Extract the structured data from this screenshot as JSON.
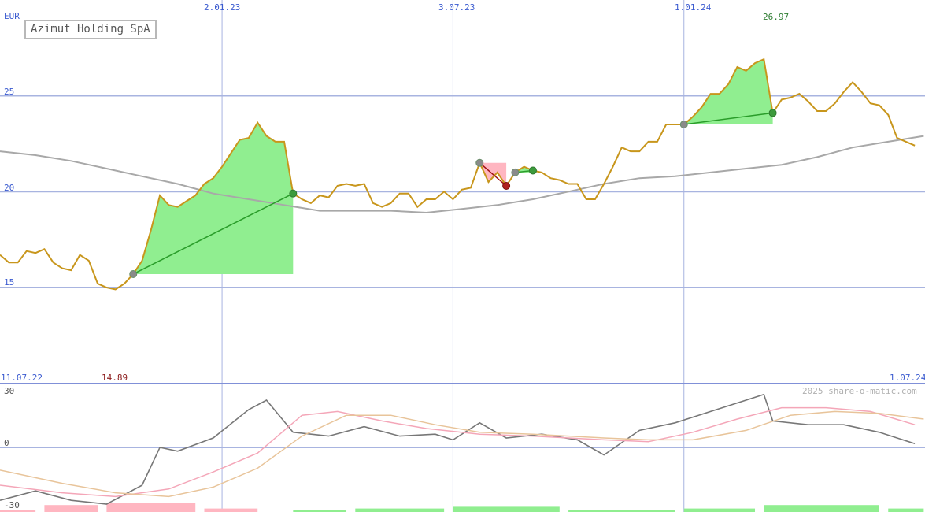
{
  "chart_data": [
    {
      "type": "line",
      "title": "Azimut Holding SpA",
      "currency_label": "EUR",
      "x_range": [
        "2022-07-11",
        "2024-07-09"
      ],
      "x_labels": [
        "2.01.23",
        "3.07.23",
        "1.01.24"
      ],
      "range_start_label": "11.07.22",
      "range_end_label": "1.07.24",
      "y_ticks": [
        "25",
        "20",
        "15"
      ],
      "ylim": [
        13.4,
        29.8
      ],
      "low_label": "14.89",
      "high_label": "26.97",
      "series": [
        {
          "color": "#c8961c",
          "points": [
            [
              "2022-07-11",
              16.7
            ],
            [
              "2022-07-18",
              16.3
            ],
            [
              "2022-07-25",
              16.3
            ],
            [
              "2022-08-01",
              16.9
            ],
            [
              "2022-08-08",
              16.8
            ],
            [
              "2022-08-15",
              17.0
            ],
            [
              "2022-08-22",
              16.3
            ],
            [
              "2022-08-29",
              16.0
            ],
            [
              "2022-09-05",
              15.9
            ],
            [
              "2022-09-12",
              16.7
            ],
            [
              "2022-09-19",
              16.4
            ],
            [
              "2022-09-26",
              15.2
            ],
            [
              "2022-10-03",
              15.0
            ],
            [
              "2022-10-10",
              14.9
            ],
            [
              "2022-10-17",
              15.2
            ],
            [
              "2022-10-24",
              15.7
            ],
            [
              "2022-10-31",
              16.4
            ],
            [
              "2022-11-07",
              18.0
            ],
            [
              "2022-11-14",
              19.8
            ],
            [
              "2022-11-21",
              19.3
            ],
            [
              "2022-11-28",
              19.2
            ],
            [
              "2022-12-05",
              19.5
            ],
            [
              "2022-12-12",
              19.8
            ],
            [
              "2022-12-19",
              20.4
            ],
            [
              "2022-12-26",
              20.7
            ],
            [
              "2023-01-02",
              21.3
            ],
            [
              "2023-01-09",
              22.0
            ],
            [
              "2023-01-16",
              22.7
            ],
            [
              "2023-01-23",
              22.8
            ],
            [
              "2023-01-30",
              23.6
            ],
            [
              "2023-02-06",
              22.9
            ],
            [
              "2023-02-13",
              22.6
            ],
            [
              "2023-02-20",
              22.6
            ],
            [
              "2023-02-27",
              19.9
            ],
            [
              "2023-03-06",
              19.6
            ],
            [
              "2023-03-13",
              19.4
            ],
            [
              "2023-03-20",
              19.8
            ],
            [
              "2023-03-27",
              19.7
            ],
            [
              "2023-04-03",
              20.3
            ],
            [
              "2023-04-10",
              20.4
            ],
            [
              "2023-04-17",
              20.3
            ],
            [
              "2023-04-24",
              20.4
            ],
            [
              "2023-05-01",
              19.4
            ],
            [
              "2023-05-08",
              19.2
            ],
            [
              "2023-05-15",
              19.4
            ],
            [
              "2023-05-22",
              19.9
            ],
            [
              "2023-05-29",
              19.9
            ],
            [
              "2023-06-05",
              19.2
            ],
            [
              "2023-06-12",
              19.6
            ],
            [
              "2023-06-19",
              19.6
            ],
            [
              "2023-06-26",
              20.0
            ],
            [
              "2023-07-03",
              19.6
            ],
            [
              "2023-07-10",
              20.1
            ],
            [
              "2023-07-17",
              20.2
            ],
            [
              "2023-07-24",
              21.5
            ],
            [
              "2023-07-31",
              20.5
            ],
            [
              "2023-08-07",
              21.0
            ],
            [
              "2023-08-14",
              20.3
            ],
            [
              "2023-08-21",
              21.0
            ],
            [
              "2023-08-28",
              21.3
            ],
            [
              "2023-09-04",
              21.1
            ],
            [
              "2023-09-11",
              21.0
            ],
            [
              "2023-09-18",
              20.7
            ],
            [
              "2023-09-25",
              20.6
            ],
            [
              "2023-10-02",
              20.4
            ],
            [
              "2023-10-09",
              20.4
            ],
            [
              "2023-10-16",
              19.6
            ],
            [
              "2023-10-23",
              19.6
            ],
            [
              "2023-10-30",
              20.4
            ],
            [
              "2023-11-06",
              21.3
            ],
            [
              "2023-11-13",
              22.3
            ],
            [
              "2023-11-20",
              22.1
            ],
            [
              "2023-11-27",
              22.1
            ],
            [
              "2023-12-04",
              22.6
            ],
            [
              "2023-12-11",
              22.6
            ],
            [
              "2023-12-18",
              23.5
            ],
            [
              "2024-01-01",
              23.5
            ],
            [
              "2024-01-08",
              23.9
            ],
            [
              "2024-01-15",
              24.4
            ],
            [
              "2024-01-22",
              25.1
            ],
            [
              "2024-01-29",
              25.1
            ],
            [
              "2024-02-05",
              25.6
            ],
            [
              "2024-02-12",
              26.5
            ],
            [
              "2024-02-19",
              26.3
            ],
            [
              "2024-02-26",
              26.7
            ],
            [
              "2024-03-04",
              26.9
            ],
            [
              "2024-03-11",
              24.1
            ],
            [
              "2024-03-18",
              24.8
            ],
            [
              "2024-03-25",
              24.9
            ],
            [
              "2024-04-01",
              25.1
            ],
            [
              "2024-04-08",
              24.7
            ],
            [
              "2024-04-15",
              24.2
            ],
            [
              "2024-04-22",
              24.2
            ],
            [
              "2024-04-29",
              24.6
            ],
            [
              "2024-05-06",
              25.2
            ],
            [
              "2024-05-13",
              25.7
            ],
            [
              "2024-05-20",
              25.2
            ],
            [
              "2024-05-27",
              24.6
            ],
            [
              "2024-06-03",
              24.5
            ],
            [
              "2024-06-10",
              24.0
            ],
            [
              "2024-06-17",
              22.8
            ],
            [
              "2024-06-24",
              22.6
            ],
            [
              "2024-07-01",
              22.4
            ]
          ]
        },
        {
          "color": "#a8a8a8",
          "points": [
            [
              "2022-07-11",
              22.1
            ],
            [
              "2022-08-08",
              21.9
            ],
            [
              "2022-09-05",
              21.6
            ],
            [
              "2022-10-03",
              21.2
            ],
            [
              "2022-10-31",
              20.8
            ],
            [
              "2022-11-28",
              20.4
            ],
            [
              "2022-12-26",
              19.9
            ],
            [
              "2023-01-23",
              19.6
            ],
            [
              "2023-02-20",
              19.3
            ],
            [
              "2023-03-20",
              19.0
            ],
            [
              "2023-04-17",
              19.0
            ],
            [
              "2023-05-15",
              19.0
            ],
            [
              "2023-06-12",
              18.9
            ],
            [
              "2023-07-10",
              19.1
            ],
            [
              "2023-08-07",
              19.3
            ],
            [
              "2023-09-04",
              19.6
            ],
            [
              "2023-10-02",
              20.0
            ],
            [
              "2023-10-30",
              20.4
            ],
            [
              "2023-11-27",
              20.7
            ],
            [
              "2023-12-25",
              20.8
            ],
            [
              "2024-01-22",
              21.0
            ],
            [
              "2024-02-19",
              21.2
            ],
            [
              "2024-03-18",
              21.4
            ],
            [
              "2024-04-15",
              21.8
            ],
            [
              "2024-05-13",
              22.3
            ],
            [
              "2024-06-10",
              22.6
            ],
            [
              "2024-07-08",
              22.9
            ]
          ]
        }
      ],
      "signals": [
        {
          "outcome": "gain",
          "start": [
            "2022-10-24",
            15.7
          ],
          "end": [
            "2023-02-27",
            19.9
          ]
        },
        {
          "outcome": "loss",
          "start": [
            "2023-07-24",
            21.5
          ],
          "end": [
            "2023-08-14",
            20.3
          ]
        },
        {
          "outcome": "gain",
          "start": [
            "2023-08-21",
            21.0
          ],
          "end": [
            "2023-09-04",
            21.1
          ]
        },
        {
          "outcome": "gain",
          "start": [
            "2024-01-01",
            23.5
          ],
          "end": [
            "2024-03-11",
            24.1
          ]
        }
      ],
      "colors": {
        "price": "#c8961c",
        "average": "#a8a8a8",
        "gain_fill": "#90ee90",
        "loss_fill": "#ffb6c1",
        "grid": "#a8b4e0",
        "axis_text": "#3b5bd0"
      }
    },
    {
      "type": "line",
      "y_ticks": [
        "30",
        "0",
        "-30"
      ],
      "ylim": [
        -30,
        30
      ],
      "watermark": "2025 share-o-matic.com",
      "series": [
        {
          "color": "#777777",
          "points": [
            [
              "2022-07-11",
              -28
            ],
            [
              "2022-08-08",
              -23
            ],
            [
              "2022-09-05",
              -28
            ],
            [
              "2022-10-03",
              -30
            ],
            [
              "2022-10-31",
              -20
            ],
            [
              "2022-11-14",
              0
            ],
            [
              "2022-11-28",
              -2
            ],
            [
              "2022-12-26",
              5
            ],
            [
              "2023-01-23",
              20
            ],
            [
              "2023-02-06",
              25
            ],
            [
              "2023-02-27",
              8
            ],
            [
              "2023-03-27",
              6
            ],
            [
              "2023-04-24",
              11
            ],
            [
              "2023-05-22",
              6
            ],
            [
              "2023-06-19",
              7
            ],
            [
              "2023-07-03",
              4
            ],
            [
              "2023-07-24",
              13
            ],
            [
              "2023-08-14",
              5
            ],
            [
              "2023-09-11",
              7
            ],
            [
              "2023-10-09",
              4
            ],
            [
              "2023-10-30",
              -4
            ],
            [
              "2023-11-27",
              9
            ],
            [
              "2023-12-25",
              13
            ],
            [
              "2024-01-22",
              19
            ],
            [
              "2024-02-19",
              25
            ],
            [
              "2024-03-04",
              28
            ],
            [
              "2024-03-11",
              14
            ],
            [
              "2024-04-08",
              12
            ],
            [
              "2024-05-06",
              12
            ],
            [
              "2024-06-03",
              8
            ],
            [
              "2024-07-01",
              2
            ]
          ]
        },
        {
          "color": "#f4a6b8",
          "points": [
            [
              "2022-07-11",
              -20
            ],
            [
              "2022-08-29",
              -24
            ],
            [
              "2022-10-10",
              -26
            ],
            [
              "2022-11-21",
              -22
            ],
            [
              "2022-12-26",
              -13
            ],
            [
              "2023-01-30",
              -3
            ],
            [
              "2023-03-06",
              17
            ],
            [
              "2023-04-03",
              19
            ],
            [
              "2023-05-08",
              14
            ],
            [
              "2023-06-12",
              10
            ],
            [
              "2023-07-24",
              7
            ],
            [
              "2023-09-04",
              6
            ],
            [
              "2023-10-30",
              4
            ],
            [
              "2023-12-04",
              3
            ],
            [
              "2024-01-08",
              8
            ],
            [
              "2024-02-12",
              15
            ],
            [
              "2024-03-18",
              21
            ],
            [
              "2024-04-22",
              21
            ],
            [
              "2024-05-27",
              19
            ],
            [
              "2024-07-01",
              12
            ]
          ]
        },
        {
          "color": "#e8c49a",
          "points": [
            [
              "2022-07-11",
              -12
            ],
            [
              "2022-08-29",
              -19
            ],
            [
              "2022-10-10",
              -24
            ],
            [
              "2022-11-21",
              -26
            ],
            [
              "2022-12-26",
              -21
            ],
            [
              "2023-01-30",
              -11
            ],
            [
              "2023-03-06",
              6
            ],
            [
              "2023-04-10",
              17
            ],
            [
              "2023-05-15",
              17
            ],
            [
              "2023-06-19",
              12
            ],
            [
              "2023-07-24",
              8
            ],
            [
              "2023-09-04",
              7
            ],
            [
              "2023-10-30",
              5
            ],
            [
              "2023-12-04",
              4
            ],
            [
              "2024-01-08",
              4
            ],
            [
              "2024-02-19",
              9
            ],
            [
              "2024-03-25",
              17
            ],
            [
              "2024-04-29",
              19
            ],
            [
              "2024-06-03",
              18
            ],
            [
              "2024-07-08",
              15
            ]
          ]
        }
      ],
      "histogram": [
        {
          "from": "2022-07-11",
          "to": "2022-08-08",
          "value": -1
        },
        {
          "from": "2022-08-15",
          "to": "2022-09-26",
          "value": -4
        },
        {
          "from": "2022-10-03",
          "to": "2022-12-12",
          "value": -5
        },
        {
          "from": "2022-12-19",
          "to": "2023-01-30",
          "value": -2
        },
        {
          "from": "2023-02-27",
          "to": "2023-04-10",
          "value": 1
        },
        {
          "from": "2023-04-17",
          "to": "2023-06-26",
          "value": 2
        },
        {
          "from": "2023-07-03",
          "to": "2023-09-25",
          "value": 3
        },
        {
          "from": "2023-10-02",
          "to": "2023-12-25",
          "value": 1
        },
        {
          "from": "2024-01-01",
          "to": "2024-02-26",
          "value": 2
        },
        {
          "from": "2024-03-04",
          "to": "2024-06-03",
          "value": 4
        },
        {
          "from": "2024-06-10",
          "to": "2024-07-08",
          "value": 2
        }
      ]
    }
  ]
}
